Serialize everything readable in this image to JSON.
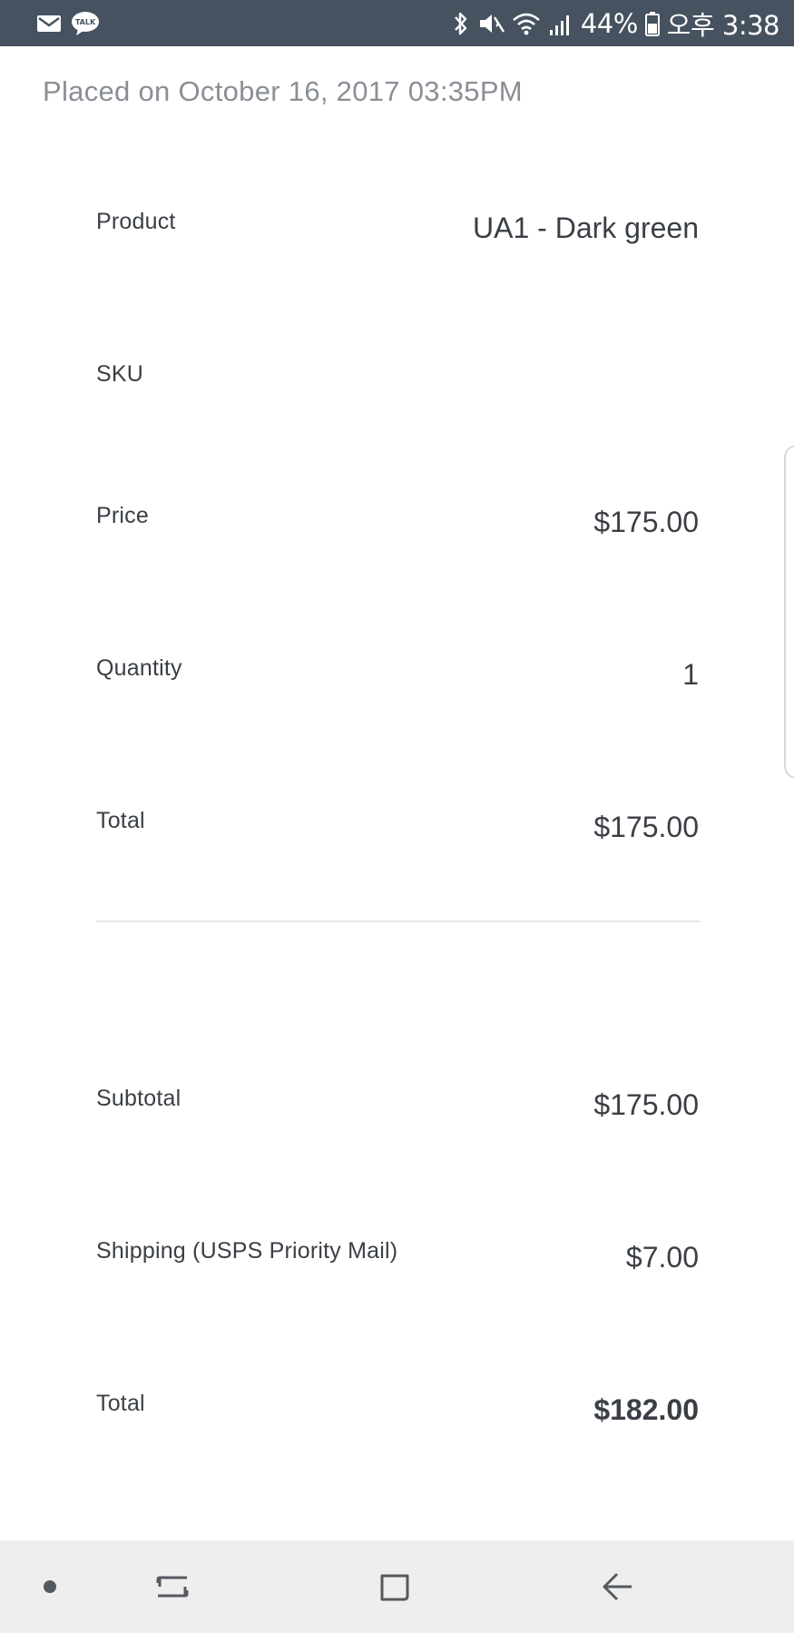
{
  "status_bar": {
    "left_icons": [
      "mail-icon",
      "kakaotalk-icon"
    ],
    "kakaotalk_label": "TALK",
    "right_icons": [
      "bluetooth-icon",
      "mute-icon",
      "wifi-icon",
      "signal-icon",
      "battery-icon"
    ],
    "battery_percent": "44%",
    "time": "오후 3:38"
  },
  "order": {
    "placed": "Placed on October 16, 2017 03:35PM",
    "item": {
      "product_label": "Product",
      "product_value": "UA1 - Dark green",
      "sku_label": "SKU",
      "sku_value": "",
      "price_label": "Price",
      "price_value": "$175.00",
      "quantity_label": "Quantity",
      "quantity_value": "1",
      "total_label": "Total",
      "total_value": "$175.00"
    },
    "summary": {
      "subtotal_label": "Subtotal",
      "subtotal_value": "$175.00",
      "shipping_label": "Shipping (USPS Priority Mail)",
      "shipping_value": "$7.00",
      "total_label": "Total",
      "total_value": "$182.00"
    }
  },
  "nav_bar": {
    "items": [
      "dot-icon",
      "recent-apps-icon",
      "home-icon",
      "back-icon"
    ]
  }
}
